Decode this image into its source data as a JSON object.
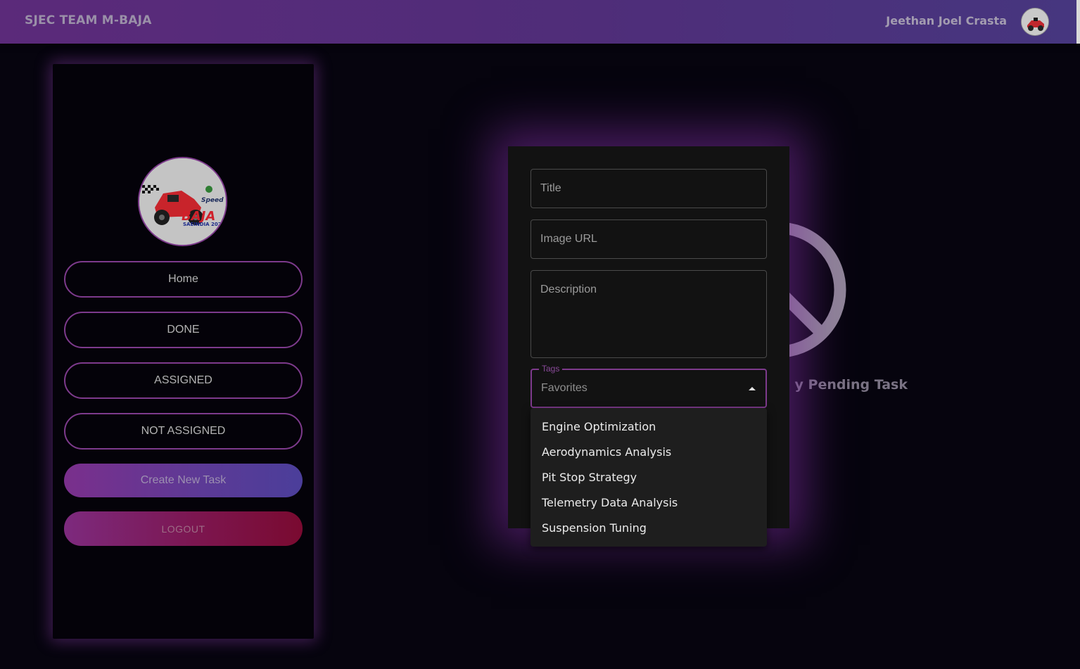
{
  "header": {
    "brand": "SJEC TEAM M-BAJA",
    "user_name": "Jeethan Joel Crasta"
  },
  "sidebar": {
    "items": [
      {
        "label": "Home"
      },
      {
        "label": "DONE"
      },
      {
        "label": "ASSIGNED"
      },
      {
        "label": "NOT ASSIGNED"
      }
    ],
    "create_label": "Create New Task",
    "logout_label": "LOGOUT",
    "logo_text": "Speed BAJA SAEINDIA 2024"
  },
  "empty_state": {
    "text": "y Pending Task",
    "icon": "no-entry-icon"
  },
  "form": {
    "title_placeholder": "Title",
    "image_url_placeholder": "Image URL",
    "description_placeholder": "Description",
    "tags_label": "Tags",
    "tags_value": "Favorites",
    "tag_options": [
      "Engine Optimization",
      "Aerodynamics Analysis",
      "Pit Stop Strategy",
      "Telemetry Data Analysis",
      "Suspension Tuning"
    ]
  },
  "colors": {
    "accent": "#7d3a8c",
    "header_start": "#5b2a7a",
    "header_end": "#46367f",
    "logout_end": "#7a0a30",
    "modal_bg": "#121212"
  }
}
